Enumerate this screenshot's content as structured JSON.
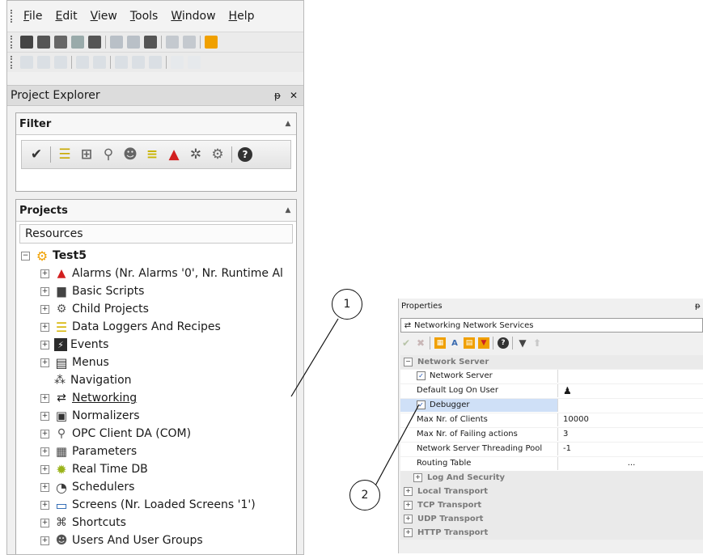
{
  "menu": {
    "items": [
      {
        "label": "File",
        "accel": "F",
        "rest": "ile"
      },
      {
        "label": "Edit",
        "accel": "E",
        "rest": "dit"
      },
      {
        "label": "View",
        "accel": "V",
        "rest": "iew"
      },
      {
        "label": "Tools",
        "accel": "T",
        "rest": "ools"
      },
      {
        "label": "Window",
        "accel": "W",
        "rest": "indow"
      },
      {
        "label": "Help",
        "accel": "H",
        "rest": "elp"
      }
    ]
  },
  "project_explorer": {
    "title": "Project Explorer",
    "pin": "੎",
    "close": "✕"
  },
  "filter": {
    "title": "Filter",
    "icons": [
      "check-icon",
      "data-logger-icon",
      "network-icon",
      "opc-icon",
      "users-icon",
      "recipe-icon",
      "alarm-icon",
      "gear-icon",
      "child-projects-icon",
      "help-icon"
    ]
  },
  "projects": {
    "title": "Projects",
    "resources_label": "Resources",
    "root": "Test5",
    "items": [
      {
        "label": "Alarms (Nr. Alarms '0', Nr. Runtime Al",
        "icon": "alarm-icon",
        "color": "#d21f1f"
      },
      {
        "label": "Basic Scripts",
        "icon": "script-icon",
        "color": "#444444"
      },
      {
        "label": "Child Projects",
        "icon": "child-projects-icon",
        "color": "#555555"
      },
      {
        "label": "Data Loggers And Recipes",
        "icon": "data-logger-icon",
        "color": "#d6b400"
      },
      {
        "label": "Events",
        "icon": "events-icon",
        "color": "#2b2b2b"
      },
      {
        "label": "Menus",
        "icon": "menu-icon",
        "color": "#333333"
      },
      {
        "label": "Navigation",
        "icon": "navigation-icon",
        "color": "#333333"
      },
      {
        "label": "Networking",
        "icon": "networking-icon",
        "color": "#1a1a1a"
      },
      {
        "label": "Normalizers",
        "icon": "normalizer-icon",
        "color": "#333333"
      },
      {
        "label": "OPC Client DA (COM)",
        "icon": "opc-icon",
        "color": "#555555"
      },
      {
        "label": "Parameters",
        "icon": "parameters-icon",
        "color": "#444444"
      },
      {
        "label": "Real Time DB",
        "icon": "realtime-db-icon",
        "color": "#9ab31a"
      },
      {
        "label": "Schedulers",
        "icon": "scheduler-icon",
        "color": "#3a3a3a"
      },
      {
        "label": "Screens (Nr. Loaded Screens '1')",
        "icon": "screen-icon",
        "color": "#1f5fae"
      },
      {
        "label": "Shortcuts",
        "icon": "shortcut-icon",
        "color": "#444444"
      },
      {
        "label": "Users And User Groups",
        "icon": "users-icon",
        "color": "#555555"
      }
    ]
  },
  "properties": {
    "title": "Properties",
    "pin": "੎",
    "object": "Networking Network Services",
    "categories": {
      "network_server": "Network Server",
      "log_security": "Log And Security",
      "local_transport": "Local Transport",
      "tcp_transport": "TCP Transport",
      "udp_transport": "UDP Transport",
      "http_transport": "HTTP Transport"
    },
    "rows": {
      "network_server": {
        "name": "Network Server",
        "checked": true
      },
      "default_user": {
        "name": "Default Log On User",
        "value": ""
      },
      "debugger": {
        "name": "Debugger",
        "checked": true
      },
      "max_clients": {
        "name": "Max Nr. of Clients",
        "value": "10000"
      },
      "max_failing": {
        "name": "Max Nr. of Failing actions",
        "value": "3"
      },
      "threading_pool": {
        "name": "Network Server Threading Pool",
        "value": "-1"
      },
      "routing_table": {
        "name": "Routing Table",
        "value": "..."
      }
    }
  },
  "callouts": {
    "one": "1",
    "two": "2"
  },
  "colors": {
    "highlight_row": "#cfe0f7",
    "accent_orange": "#f0a000",
    "category_gray": "#7a7a7a"
  }
}
